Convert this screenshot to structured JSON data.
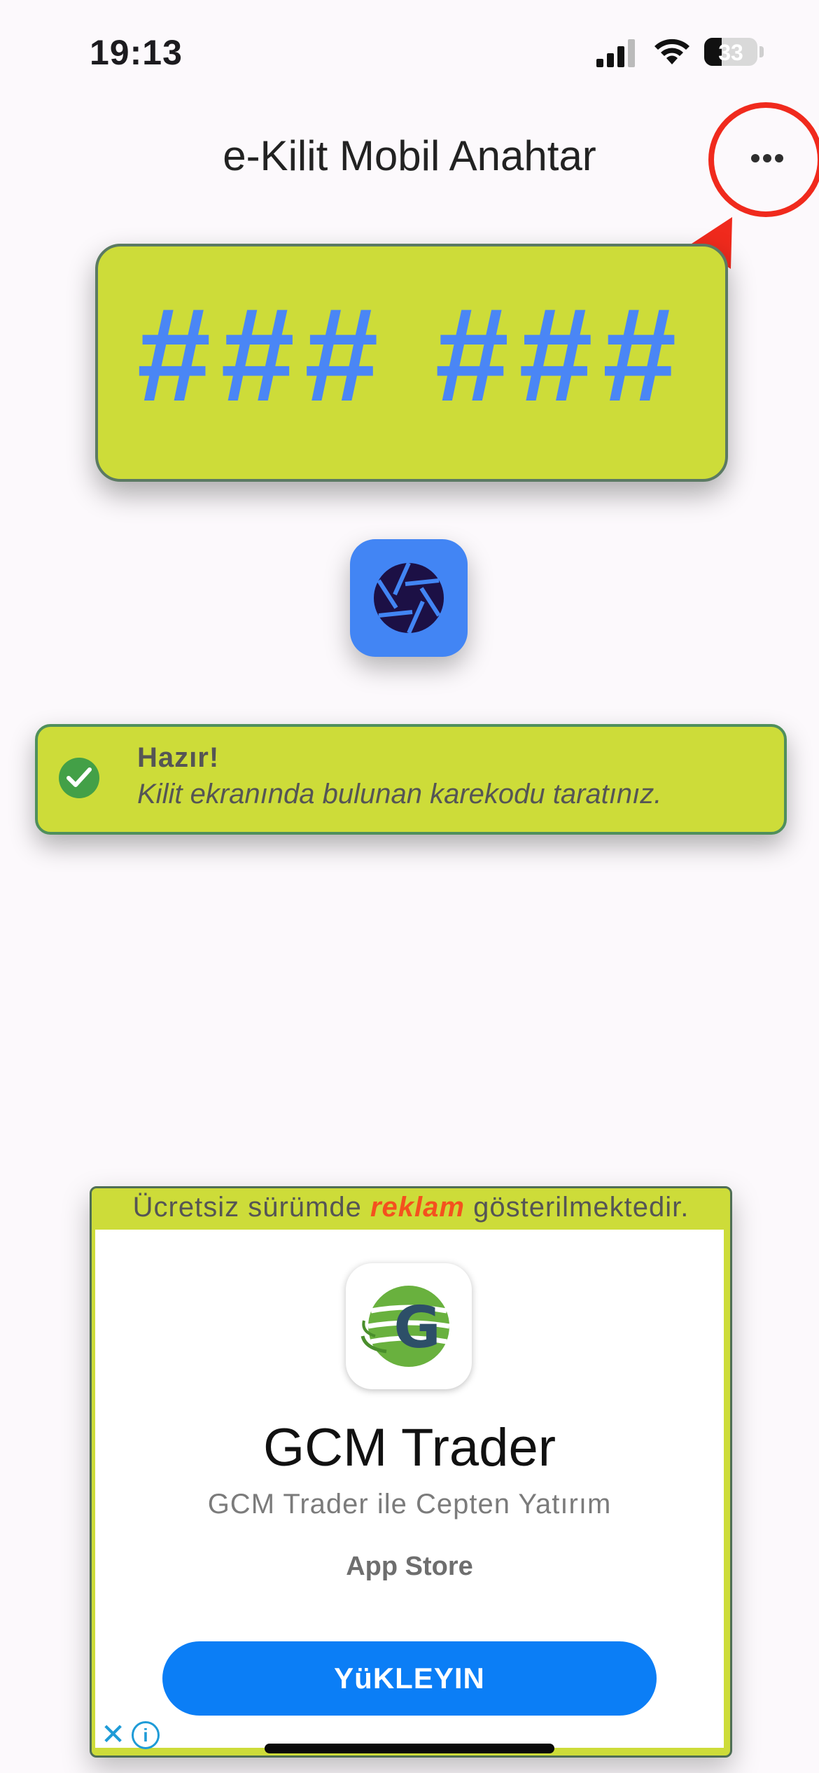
{
  "status_bar": {
    "time": "19:13",
    "battery": "33"
  },
  "app_bar": {
    "title": "e-Kilit Mobil Anahtar",
    "menu_icon": "more-horiz-icon"
  },
  "code_display": {
    "code": "### ###"
  },
  "camera_button": {
    "icon": "camera-shutter-icon"
  },
  "status": {
    "icon": "check-circle-icon",
    "title": "Hazır!",
    "message": "Kilit ekranında bulunan karekodu taratınız."
  },
  "ad": {
    "notice_before": "Ücretsiz sürümde ",
    "notice_highlight": "reklam",
    "notice_after": " gösterilmektedir.",
    "app_name": "GCM Trader",
    "tagline": "GCM Trader ile Cepten Yatırım",
    "store": "App Store",
    "install_label": "YüKLEYIN"
  },
  "colors": {
    "accent_lime": "#cddc39",
    "code_blue": "#4a86f5",
    "install_blue": "#0b7ef6",
    "annotation_red": "#f02a1d"
  }
}
